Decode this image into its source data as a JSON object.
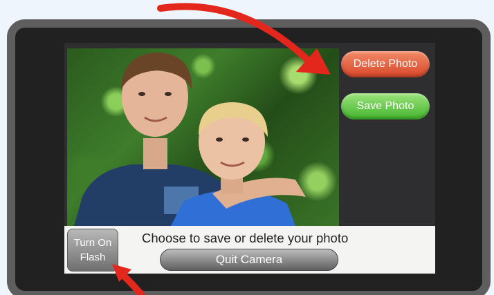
{
  "buttons": {
    "delete": "Delete Photo",
    "save": "Save Photo",
    "flash_line1": "Turn On",
    "flash_line2": "Flash",
    "quit": "Quit Camera"
  },
  "status": "Choose to save or delete your photo",
  "colors": {
    "delete": "#e05a3a",
    "save": "#5cc43e",
    "arrow": "#e3271d"
  }
}
